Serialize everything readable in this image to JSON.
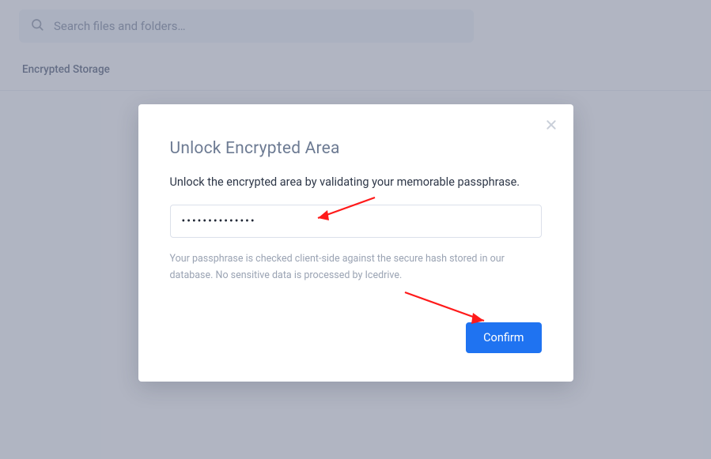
{
  "header": {
    "search_placeholder": "Search files and folders…"
  },
  "breadcrumb": {
    "label": "Encrypted Storage"
  },
  "modal": {
    "title": "Unlock Encrypted Area",
    "description": "Unlock the encrypted area by validating your memorable passphrase.",
    "passphrase_value": "••••••••••••••",
    "note": "Your passphrase is checked client-side against the secure hash stored in our database. No sensitive data is processed by Icedrive.",
    "confirm_label": "Confirm"
  }
}
